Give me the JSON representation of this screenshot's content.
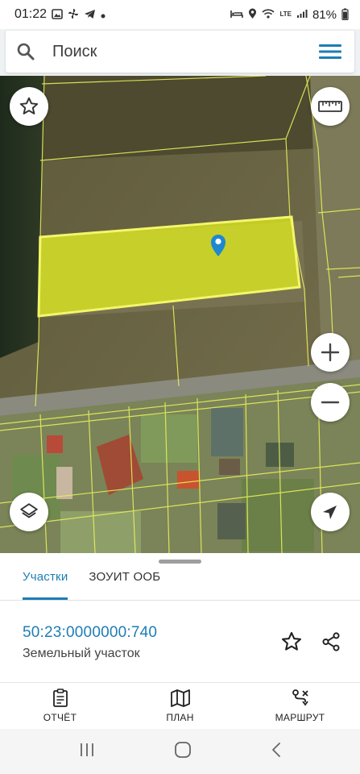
{
  "status_bar": {
    "time": "01:22",
    "left_icons": [
      "image-icon",
      "fan-icon",
      "telegram-icon",
      "dot-icon"
    ],
    "network": "LTE",
    "battery": "81%"
  },
  "search": {
    "placeholder": "Поиск"
  },
  "map": {
    "highlight_color": "#e6f21a",
    "boundary_color": "#f3f66a",
    "pin_color": "#1e88d0"
  },
  "sheet": {
    "tabs": [
      {
        "label": "Участки",
        "active": true
      },
      {
        "label": "ЗОУИТ ООБ",
        "active": false
      }
    ],
    "parcel": {
      "cadastral_number": "50:23:0000000:740",
      "type": "Земельный участок"
    }
  },
  "bottom_nav": [
    {
      "label": "ОТЧЁТ",
      "icon": "report-icon"
    },
    {
      "label": "ПЛАН",
      "icon": "map-plan-icon"
    },
    {
      "label": "МАРШРУТ",
      "icon": "route-icon"
    }
  ],
  "colors": {
    "accent": "#1e7db5"
  }
}
